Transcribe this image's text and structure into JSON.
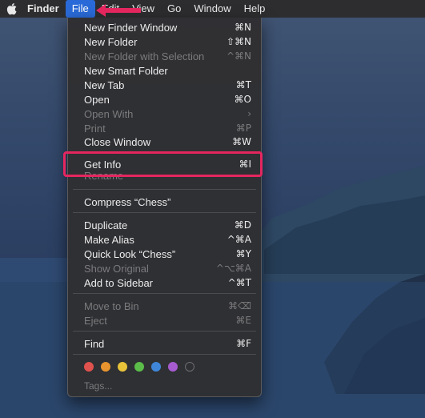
{
  "menubar": {
    "app_name": "Finder",
    "items": [
      "File",
      "Edit",
      "View",
      "Go",
      "Window",
      "Help"
    ],
    "active_index": 0
  },
  "file_menu": {
    "items": [
      {
        "label": "New Finder Window",
        "shortcut": "⌘N",
        "enabled": true
      },
      {
        "label": "New Folder",
        "shortcut": "⇧⌘N",
        "enabled": true
      },
      {
        "label": "New Folder with Selection",
        "shortcut": "^⌘N",
        "enabled": false
      },
      {
        "label": "New Smart Folder",
        "shortcut": "",
        "enabled": true
      },
      {
        "label": "New Tab",
        "shortcut": "⌘T",
        "enabled": true
      },
      {
        "label": "Open",
        "shortcut": "⌘O",
        "enabled": true
      },
      {
        "label": "Open With",
        "shortcut": "",
        "enabled": false
      },
      {
        "label": "Print",
        "shortcut": "⌘P",
        "enabled": false
      },
      {
        "label": "Close Window",
        "shortcut": "⌘W",
        "enabled": true
      },
      {
        "label": "Get Info",
        "shortcut": "⌘I",
        "enabled": true
      },
      {
        "label": "Rename",
        "shortcut": "",
        "enabled": false
      },
      {
        "label": "Compress “Chess”",
        "shortcut": "",
        "enabled": true
      },
      {
        "label": "Duplicate",
        "shortcut": "⌘D",
        "enabled": true
      },
      {
        "label": "Make Alias",
        "shortcut": "^⌘A",
        "enabled": true
      },
      {
        "label": "Quick Look “Chess”",
        "shortcut": "⌘Y",
        "enabled": true
      },
      {
        "label": "Show Original",
        "shortcut": "^⌥⌘A",
        "enabled": false
      },
      {
        "label": "Add to Sidebar",
        "shortcut": "^⌘T",
        "enabled": true
      },
      {
        "label": "Move to Bin",
        "shortcut": "⌘⌫",
        "enabled": false
      },
      {
        "label": "Eject",
        "shortcut": "⌘E",
        "enabled": false
      },
      {
        "label": "Find",
        "shortcut": "⌘F",
        "enabled": true
      }
    ],
    "tags_label": "Tags...",
    "tag_colors": [
      "#e0524d",
      "#e8952f",
      "#e8c33a",
      "#5cbc4a",
      "#3f86d9",
      "#a65bcf",
      "none"
    ]
  },
  "annotation": {
    "highlight_color": "#e4265f",
    "highlighted_item": "Get Info"
  }
}
